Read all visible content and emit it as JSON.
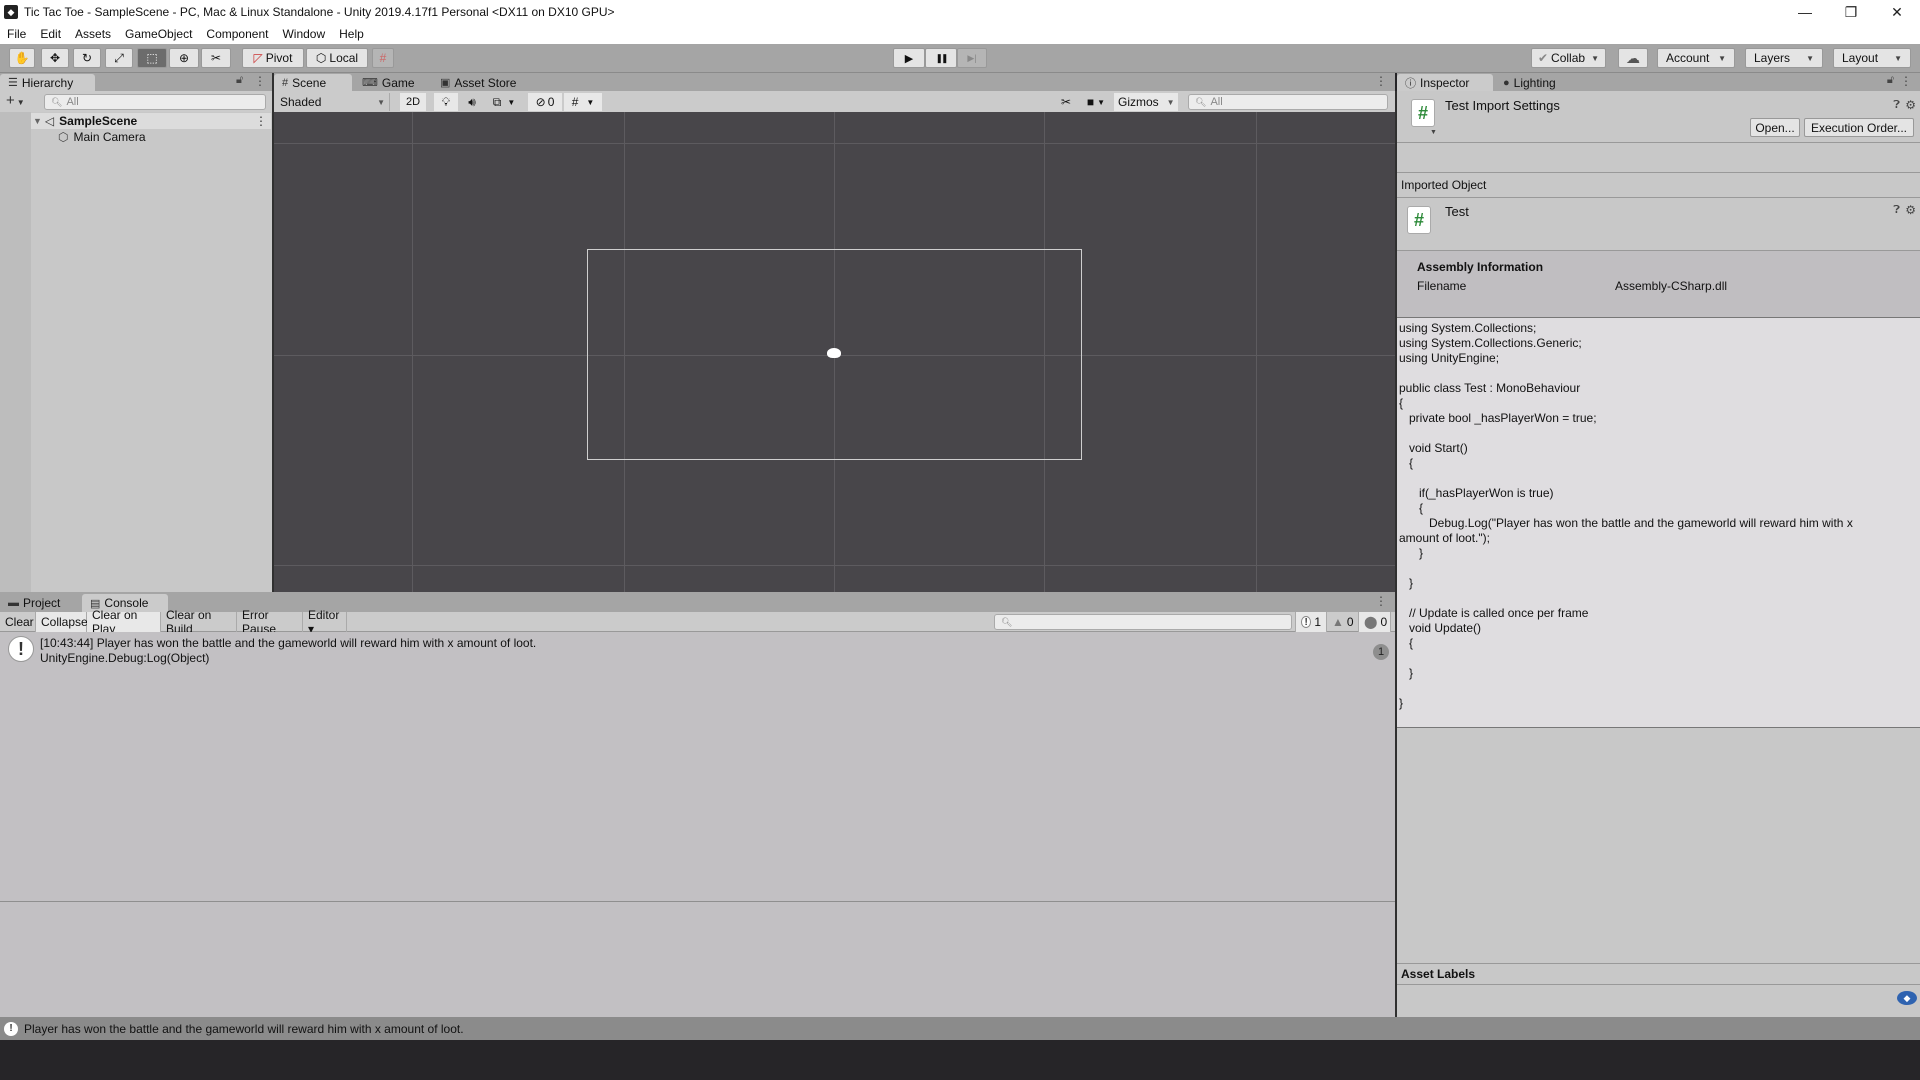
{
  "window": {
    "title": "Tic Tac Toe - SampleScene - PC, Mac & Linux Standalone - Unity 2019.4.17f1 Personal <DX11 on DX10 GPU>",
    "controls": {
      "minimize": "—",
      "restore": "❐",
      "close": "✕"
    }
  },
  "menu": [
    "File",
    "Edit",
    "Assets",
    "GameObject",
    "Component",
    "Window",
    "Help"
  ],
  "toolbar": {
    "tools": [
      {
        "name": "hand-tool",
        "glyph": "✋"
      },
      {
        "name": "move-tool",
        "glyph": "✥"
      },
      {
        "name": "rotate-tool",
        "glyph": "↻"
      },
      {
        "name": "scale-tool",
        "glyph": "⤢"
      },
      {
        "name": "rect-tool",
        "glyph": "⬚"
      },
      {
        "name": "transform-tool",
        "glyph": "⊕"
      },
      {
        "name": "custom-tool",
        "glyph": "✂"
      }
    ],
    "active_tool": "rect-tool",
    "pivot_label": "Pivot",
    "local_label": "Local",
    "snap_glyph": "#",
    "play_glyph": "▶",
    "pause_glyph": "❚❚",
    "step_glyph": "▶|",
    "collab_label": "Collab",
    "cloud_glyph": "☁",
    "account_label": "Account",
    "layers_label": "Layers",
    "layout_label": "Layout"
  },
  "hierarchy": {
    "tab_label": "Hierarchy",
    "add_label": "+",
    "search_placeholder": "All",
    "items": [
      {
        "label": "SampleScene",
        "bold": true,
        "expanded": true
      },
      {
        "label": "Main Camera",
        "bold": false
      }
    ]
  },
  "scene": {
    "tabs": [
      {
        "label": "Scene",
        "icon": "#",
        "active": true
      },
      {
        "label": "Game",
        "icon": "🎮",
        "active": false
      },
      {
        "label": "Asset Store",
        "icon": "🛍",
        "active": false
      }
    ],
    "shading_mode": "Shaded",
    "mode_2d": "2D",
    "hidden_count": "0",
    "gizmos_label": "Gizmos",
    "search_placeholder": "All"
  },
  "console": {
    "tabs": [
      {
        "label": "Project",
        "active": false
      },
      {
        "label": "Console",
        "active": true
      }
    ],
    "buttons": [
      {
        "label": "Clear",
        "on": false
      },
      {
        "label": "Collapse",
        "on": true
      },
      {
        "label": "Clear on Play",
        "on": true
      },
      {
        "label": "Clear on Build",
        "on": false
      },
      {
        "label": "Error Pause",
        "on": false
      },
      {
        "label": "Editor ▾",
        "on": false
      }
    ],
    "search_value": "",
    "counts": {
      "log": "1",
      "warning": "0",
      "error": "0"
    },
    "entries": [
      {
        "line1": "[10:43:44] Player has won the battle and the gameworld will reward him with x amount of loot.",
        "line2": "UnityEngine.Debug:Log(Object)",
        "count": "1"
      }
    ]
  },
  "inspector": {
    "tabs": [
      {
        "label": "Inspector",
        "active": true
      },
      {
        "label": "Lighting",
        "active": false
      }
    ],
    "header_title": "Test Import Settings",
    "open_button": "Open...",
    "execution_order_button": "Execution Order...",
    "imported_object_label": "Imported Object",
    "object_name": "Test",
    "assembly_info_title": "Assembly Information",
    "filename_label": "Filename",
    "filename_value": "Assembly-CSharp.dll",
    "code": "using System.Collections;\nusing System.Collections.Generic;\nusing UnityEngine;\n\npublic class Test : MonoBehaviour\n{\n   private bool _hasPlayerWon = true;\n\n   void Start()\n   {\n\n      if(_hasPlayerWon is true)\n      {\n         Debug.Log(\"Player has won the battle and the gameworld will reward him with x\namount of loot.\");\n      }\n\n   }\n\n   // Update is called once per frame\n   void Update()\n   {\n\n   }\n\n}",
    "asset_labels_title": "Asset Labels"
  },
  "statusbar": {
    "message": "Player has won the battle and the gameworld will reward him with x amount of loot."
  },
  "colors": {
    "script_icon_green": "#2e8b3a",
    "scene_bg": "#48464a",
    "label_tag_blue": "#2f63b0"
  }
}
